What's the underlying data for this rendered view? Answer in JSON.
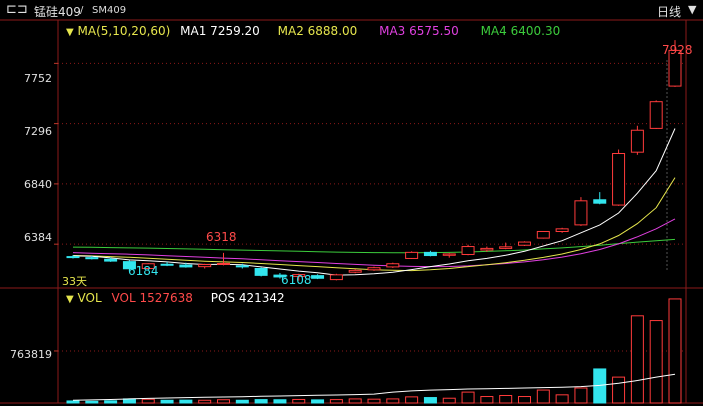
{
  "header": {
    "nav_icon": "split-pane-icon",
    "title": "锰硅409",
    "separator": "/",
    "code": "SM409",
    "period": "日线",
    "dropdown_icon": "chevron-down-icon"
  },
  "ma_legend": {
    "label": "MA(5,10,20,60)",
    "ma1": "MA1 7259.20",
    "ma2": "MA2 6888.00",
    "ma3": "MA3 6575.50",
    "ma4": "MA4 6400.30"
  },
  "vol_legend": {
    "label": "VOL",
    "vol": "VOL 1527638",
    "pos": "POS 421342"
  },
  "colors": {
    "up": "#ff3b3b",
    "down": "#33e5ee",
    "ma1": "#ffffff",
    "ma2": "#e6e64d",
    "ma3": "#e040e0",
    "ma4": "#3ccc3c",
    "grid": "#8b1a1a"
  },
  "chart_data": [
    {
      "type": "candlestick",
      "y_ticks": [
        "7752",
        "7296",
        "6840",
        "6384"
      ],
      "ylim": [
        6060,
        8080
      ],
      "annotations": {
        "high": "7928",
        "low_left": "6184",
        "high_mid": "6318",
        "low_mid": "6108",
        "days": "33天"
      },
      "candles": [
        {
          "o": 6290,
          "h": 6302,
          "l": 6276,
          "c": 6284
        },
        {
          "o": 6282,
          "h": 6296,
          "l": 6268,
          "c": 6274
        },
        {
          "o": 6270,
          "h": 6284,
          "l": 6250,
          "c": 6256
        },
        {
          "o": 6252,
          "h": 6262,
          "l": 6184,
          "c": 6198
        },
        {
          "o": 6200,
          "h": 6240,
          "l": 6194,
          "c": 6236
        },
        {
          "o": 6232,
          "h": 6250,
          "l": 6218,
          "c": 6226
        },
        {
          "o": 6226,
          "h": 6244,
          "l": 6206,
          "c": 6212
        },
        {
          "o": 6214,
          "h": 6236,
          "l": 6200,
          "c": 6230
        },
        {
          "o": 6234,
          "h": 6318,
          "l": 6224,
          "c": 6238
        },
        {
          "o": 6220,
          "h": 6236,
          "l": 6200,
          "c": 6218
        },
        {
          "o": 6200,
          "h": 6210,
          "l": 6140,
          "c": 6148
        },
        {
          "o": 6150,
          "h": 6166,
          "l": 6124,
          "c": 6136
        },
        {
          "o": 6140,
          "h": 6160,
          "l": 6108,
          "c": 6154
        },
        {
          "o": 6146,
          "h": 6156,
          "l": 6120,
          "c": 6126
        },
        {
          "o": 6116,
          "h": 6160,
          "l": 6110,
          "c": 6152
        },
        {
          "o": 6172,
          "h": 6196,
          "l": 6164,
          "c": 6186
        },
        {
          "o": 6190,
          "h": 6214,
          "l": 6182,
          "c": 6206
        },
        {
          "o": 6212,
          "h": 6244,
          "l": 6204,
          "c": 6236
        },
        {
          "o": 6276,
          "h": 6330,
          "l": 6272,
          "c": 6322
        },
        {
          "o": 6322,
          "h": 6334,
          "l": 6292,
          "c": 6298
        },
        {
          "o": 6300,
          "h": 6316,
          "l": 6282,
          "c": 6310
        },
        {
          "o": 6306,
          "h": 6380,
          "l": 6300,
          "c": 6366
        },
        {
          "o": 6340,
          "h": 6366,
          "l": 6326,
          "c": 6352
        },
        {
          "o": 6352,
          "h": 6396,
          "l": 6346,
          "c": 6364
        },
        {
          "o": 6376,
          "h": 6406,
          "l": 6370,
          "c": 6400
        },
        {
          "o": 6430,
          "h": 6480,
          "l": 6426,
          "c": 6480
        },
        {
          "o": 6480,
          "h": 6508,
          "l": 6470,
          "c": 6500
        },
        {
          "o": 6530,
          "h": 6740,
          "l": 6522,
          "c": 6712
        },
        {
          "o": 6720,
          "h": 6778,
          "l": 6686,
          "c": 6694
        },
        {
          "o": 6680,
          "h": 7100,
          "l": 6674,
          "c": 7070
        },
        {
          "o": 7080,
          "h": 7280,
          "l": 7060,
          "c": 7246
        },
        {
          "o": 7260,
          "h": 7472,
          "l": 7256,
          "c": 7462
        },
        {
          "o": 7580,
          "h": 7928,
          "l": 7574,
          "c": 7850
        }
      ],
      "ma1": [
        6295,
        6292,
        6280,
        6265,
        6258,
        6250,
        6238,
        6230,
        6232,
        6228,
        6212,
        6196,
        6180,
        6168,
        6150,
        6152,
        6160,
        6172,
        6192,
        6214,
        6234,
        6258,
        6276,
        6300,
        6330,
        6370,
        6410,
        6470,
        6530,
        6620,
        6770,
        6940,
        7259
      ],
      "ma2": [
        6298,
        6295,
        6290,
        6285,
        6278,
        6270,
        6262,
        6255,
        6250,
        6245,
        6238,
        6230,
        6222,
        6214,
        6206,
        6198,
        6190,
        6186,
        6184,
        6190,
        6200,
        6214,
        6228,
        6244,
        6262,
        6284,
        6310,
        6344,
        6386,
        6450,
        6540,
        6660,
        6888
      ],
      "ma3": [
        6320,
        6316,
        6312,
        6308,
        6303,
        6297,
        6291,
        6285,
        6279,
        6273,
        6266,
        6259,
        6252,
        6245,
        6238,
        6231,
        6225,
        6220,
        6216,
        6214,
        6215,
        6220,
        6228,
        6238,
        6250,
        6266,
        6286,
        6312,
        6344,
        6386,
        6440,
        6500,
        6575
      ],
      "ma4": [
        6362,
        6360,
        6358,
        6356,
        6354,
        6351,
        6348,
        6345,
        6342,
        6339,
        6336,
        6333,
        6330,
        6327,
        6324,
        6322,
        6320,
        6319,
        6319,
        6320,
        6322,
        6325,
        6329,
        6334,
        6340,
        6348,
        6356,
        6366,
        6376,
        6388,
        6400,
        6410,
        6420
      ]
    },
    {
      "type": "bar",
      "y_ticks": [
        "763819"
      ],
      "ylim": [
        0,
        1600000
      ],
      "volume": [
        30000,
        25000,
        32000,
        60000,
        55000,
        40000,
        42000,
        40000,
        48000,
        40000,
        50000,
        48000,
        52000,
        46000,
        50000,
        60000,
        56000,
        60000,
        90000,
        80000,
        70000,
        160000,
        95000,
        110000,
        95000,
        190000,
        120000,
        220000,
        500000,
        380000,
        1280000,
        1210000,
        1527638
      ],
      "position": [
        40000,
        45000,
        52000,
        60000,
        68000,
        74000,
        80000,
        84000,
        88000,
        92000,
        98000,
        103000,
        108000,
        113000,
        118000,
        124000,
        130000,
        160000,
        178000,
        190000,
        197000,
        205000,
        210000,
        215000,
        220000,
        226000,
        232000,
        240000,
        258000,
        290000,
        330000,
        380000,
        421342
      ]
    }
  ]
}
